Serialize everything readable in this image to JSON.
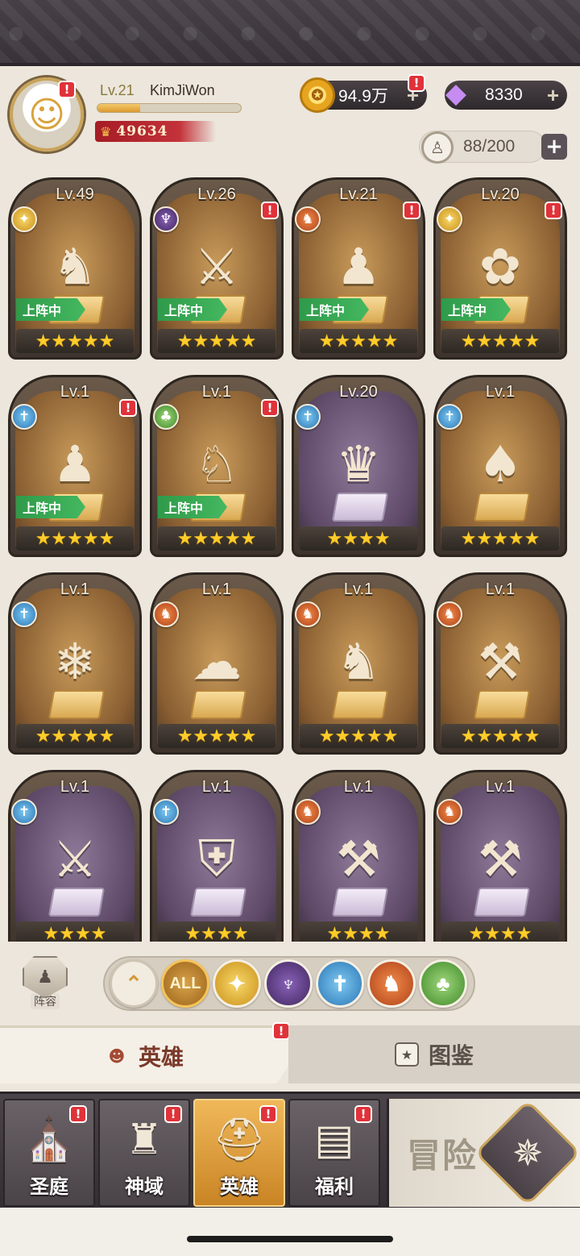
{
  "header": {
    "player_level": "Lv.21",
    "player_name": "KimJiWon",
    "xp_progress": 0.3,
    "combat_power": "49634",
    "gold": "94.9万",
    "gems": "8330",
    "hero_slots": "88/200",
    "alert_mark": "!"
  },
  "heroes": [
    {
      "level": "Lv.49",
      "faction": "light",
      "in_team": true,
      "stars": "★★★★★",
      "alert": false,
      "icon": "♞",
      "bg": "gold"
    },
    {
      "level": "Lv.26",
      "faction": "dark",
      "in_team": true,
      "stars": "★★★★★",
      "alert": true,
      "icon": "⚔",
      "bg": "gold"
    },
    {
      "level": "Lv.21",
      "faction": "beast",
      "in_team": true,
      "stars": "★★★★★",
      "alert": true,
      "icon": "♟",
      "bg": "gold"
    },
    {
      "level": "Lv.20",
      "faction": "light",
      "in_team": true,
      "stars": "★★★★★",
      "alert": true,
      "icon": "✿",
      "bg": "gold"
    },
    {
      "level": "Lv.1",
      "faction": "holy",
      "in_team": true,
      "stars": "★★★★★",
      "alert": true,
      "icon": "♟",
      "bg": "gold"
    },
    {
      "level": "Lv.1",
      "faction": "nature",
      "in_team": true,
      "stars": "★★★★★",
      "alert": true,
      "icon": "♘",
      "bg": "gold"
    },
    {
      "level": "Lv.20",
      "faction": "holy",
      "in_team": false,
      "stars": "★★★★",
      "alert": false,
      "icon": "♛",
      "bg": "purple"
    },
    {
      "level": "Lv.1",
      "faction": "holy",
      "in_team": false,
      "stars": "★★★★★",
      "alert": false,
      "icon": "♠",
      "bg": "gold"
    },
    {
      "level": "Lv.1",
      "faction": "holy",
      "in_team": false,
      "stars": "★★★★★",
      "alert": false,
      "icon": "❄",
      "bg": "gold"
    },
    {
      "level": "Lv.1",
      "faction": "beast",
      "in_team": false,
      "stars": "★★★★★",
      "alert": false,
      "icon": "☁",
      "bg": "gold"
    },
    {
      "level": "Lv.1",
      "faction": "beast",
      "in_team": false,
      "stars": "★★★★★",
      "alert": false,
      "icon": "♞",
      "bg": "gold"
    },
    {
      "level": "Lv.1",
      "faction": "beast",
      "in_team": false,
      "stars": "★★★★★",
      "alert": false,
      "icon": "⚒",
      "bg": "gold"
    },
    {
      "level": "Lv.1",
      "faction": "holy",
      "in_team": false,
      "stars": "★★★★",
      "alert": false,
      "icon": "⚔",
      "bg": "purple"
    },
    {
      "level": "Lv.1",
      "faction": "holy",
      "in_team": false,
      "stars": "★★★★",
      "alert": false,
      "icon": "⛨",
      "bg": "purple"
    },
    {
      "level": "Lv.1",
      "faction": "beast",
      "in_team": false,
      "stars": "★★★★",
      "alert": false,
      "icon": "⚒",
      "bg": "purple"
    },
    {
      "level": "Lv.1",
      "faction": "beast",
      "in_team": false,
      "stars": "★★★★",
      "alert": false,
      "icon": "⚒",
      "bg": "purple"
    }
  ],
  "in_team_label": "上阵中",
  "filter": {
    "lineup_label": "阵容",
    "all_label": "ALL"
  },
  "tabs": {
    "heroes": "英雄",
    "codex": "图鉴"
  },
  "nav": {
    "items": [
      {
        "label": "圣庭",
        "icon": "⛪",
        "alert": true
      },
      {
        "label": "神域",
        "icon": "♜",
        "alert": true
      },
      {
        "label": "英雄",
        "icon": "⛑",
        "alert": true
      },
      {
        "label": "福利",
        "icon": "▤",
        "alert": true
      }
    ],
    "adventure": "冒险"
  }
}
